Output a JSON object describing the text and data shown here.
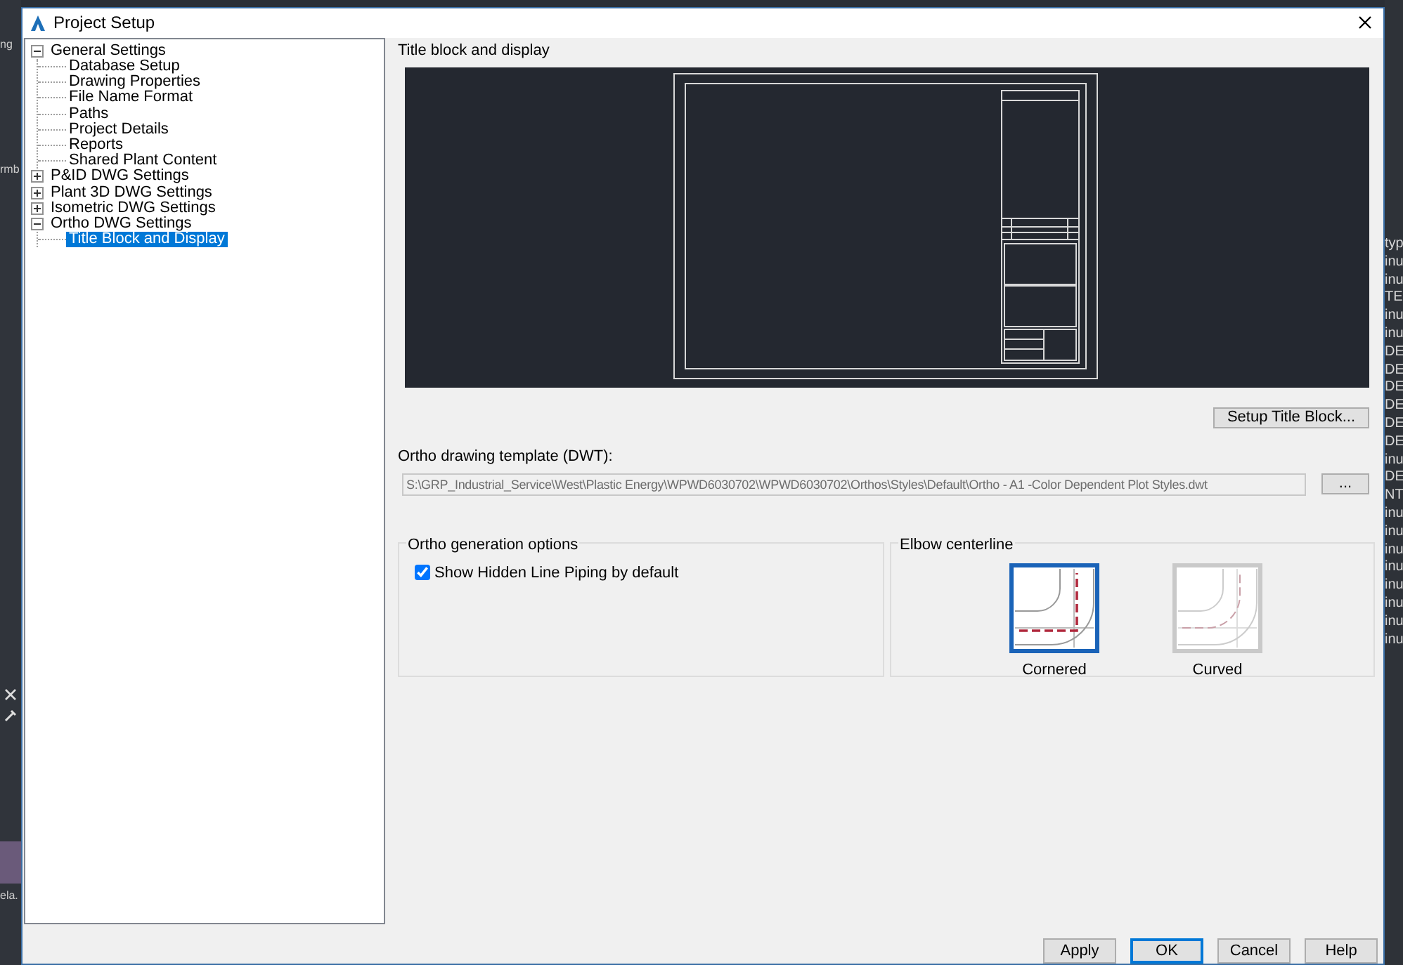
{
  "background": {
    "left_texts": [
      "ng",
      "rmb",
      "ela."
    ],
    "right_texts": [
      "typ",
      "inu",
      "inu",
      "TE",
      "inu",
      "inu",
      "DE",
      "DE",
      "DE",
      "DE",
      "DE",
      "DE",
      "inu",
      "DE",
      "NT",
      "inu",
      "inu",
      "inu",
      "inu",
      "inu",
      "inu",
      "inu",
      "inu"
    ]
  },
  "window": {
    "title": "Project Setup"
  },
  "tree": [
    {
      "label": "General Settings",
      "expanded": true,
      "selected": false,
      "children": [
        {
          "label": "Database Setup",
          "selected": false
        },
        {
          "label": "Drawing Properties",
          "selected": false
        },
        {
          "label": "File Name Format",
          "selected": false
        },
        {
          "label": "Paths",
          "selected": false
        },
        {
          "label": "Project Details",
          "selected": false
        },
        {
          "label": "Reports",
          "selected": false
        },
        {
          "label": "Shared Plant Content",
          "selected": false
        }
      ]
    },
    {
      "label": "P&ID DWG Settings",
      "expanded": false,
      "selected": false
    },
    {
      "label": "Plant 3D DWG Settings",
      "expanded": false,
      "selected": false
    },
    {
      "label": "Isometric DWG Settings",
      "expanded": false,
      "selected": false
    },
    {
      "label": "Ortho DWG Settings",
      "expanded": true,
      "selected": false,
      "children": [
        {
          "label": "Title Block and Display",
          "selected": true
        }
      ]
    }
  ],
  "section_title": "Title block and display",
  "setup_button": "Setup Title Block...",
  "template": {
    "label": "Ortho drawing template (DWT):",
    "value": "S:\\GRP_Industrial_Service\\West\\Plastic Energy\\WPWD6030702\\WPWD6030702\\Orthos\\Styles\\Default\\Ortho - A1 -Color Dependent Plot Styles.dwt",
    "browse_button": "..."
  },
  "ortho_options": {
    "title": "Ortho generation options",
    "checkboxes": [
      {
        "label": "Show Hidden Line Piping by default",
        "checked": true
      }
    ]
  },
  "elbow": {
    "title": "Elbow centerline",
    "options": [
      {
        "label": "Cornered",
        "kind": "cornered",
        "selected": true
      },
      {
        "label": "Curved",
        "kind": "curved",
        "selected": false
      }
    ]
  },
  "buttons": [
    {
      "label": "Apply",
      "default": false
    },
    {
      "label": "OK",
      "default": true
    },
    {
      "label": "Cancel",
      "default": false
    },
    {
      "label": "Help",
      "default": false
    }
  ]
}
